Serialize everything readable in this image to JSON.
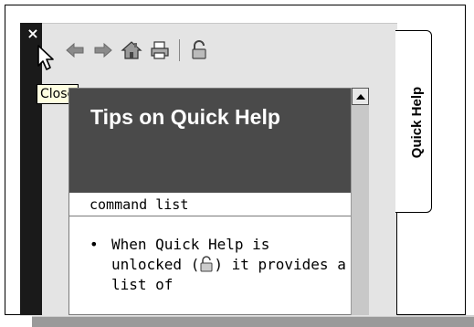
{
  "panel": {
    "close_glyph": "×",
    "tooltip": "Close",
    "tab_label": "Quick Help"
  },
  "toolbar": {
    "icons": [
      "back-arrow-icon",
      "forward-arrow-icon",
      "home-icon",
      "print-icon",
      "lock-icon"
    ]
  },
  "content": {
    "title": "Tips on Quick Help",
    "subheading": "command list",
    "items": [
      {
        "text_before": "When Quick Help is unlocked (",
        "text_after": ") it provides a list of"
      }
    ]
  },
  "colors": {
    "title_bg": "#4a4a4a",
    "side_bar": "#1a1a1a",
    "tooltip_bg": "#ffffe1"
  }
}
